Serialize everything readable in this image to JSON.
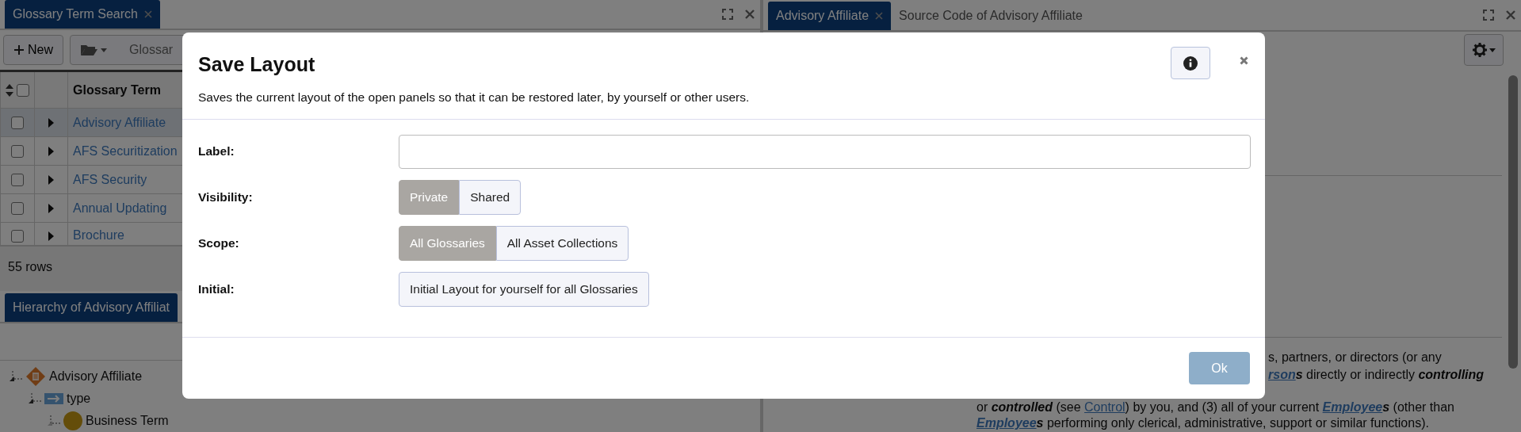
{
  "left_panel": {
    "tab": {
      "label": "Glossary Term Search"
    },
    "toolbar": {
      "new_button": "New",
      "column_3": "Glossar"
    },
    "table": {
      "select_all_checked": false,
      "columns": [
        "Glossary Term"
      ],
      "rows": [
        {
          "term": "Advisory Affiliate",
          "selected": true,
          "checked": false
        },
        {
          "term": "AFS Securitization",
          "selected": false,
          "checked": false
        },
        {
          "term": "AFS Security",
          "selected": false,
          "checked": false
        },
        {
          "term": "Annual Updating",
          "selected": false,
          "checked": false
        },
        {
          "term": "Brochure",
          "selected": false,
          "checked": false
        }
      ]
    },
    "row_count": "55 rows"
  },
  "hierarchy_panel": {
    "tab": {
      "label": "Hierarchy of Advisory Affiliat"
    },
    "tree": [
      {
        "label": "Advisory Affiliate",
        "kind": "term",
        "children": [
          {
            "label": "type",
            "kind": "relation",
            "children": [
              {
                "label": "Business Term",
                "kind": "type"
              }
            ]
          }
        ]
      }
    ]
  },
  "right_panel": {
    "tabs": [
      {
        "label": "Advisory Affiliate",
        "selected": true,
        "closable": true
      },
      {
        "label": "Source Code of Advisory Affiliate",
        "selected": false,
        "closable": false
      }
    ],
    "description_lines": [
      [
        {
          "kind": "text",
          "text": "s, partners, or directors (or any"
        }
      ],
      [
        {
          "kind": "term-link",
          "text": "rson"
        },
        {
          "kind": "emph",
          "text": "s"
        },
        {
          "kind": "text",
          "text": " directly or indirectly "
        },
        {
          "kind": "emph",
          "text": "controlling"
        }
      ],
      [
        {
          "kind": "text",
          "text": "or "
        },
        {
          "kind": "emph",
          "text": "controlled"
        },
        {
          "kind": "text",
          "text": " (see "
        },
        {
          "kind": "link",
          "text": "Control"
        },
        {
          "kind": "text",
          "text": ") by you, and (3) all of your current "
        },
        {
          "kind": "term-link",
          "text": "Employee"
        },
        {
          "kind": "emph",
          "text": "s"
        },
        {
          "kind": "text",
          "text": " (other than"
        }
      ],
      [
        {
          "kind": "term-link",
          "text": "Employee"
        },
        {
          "kind": "emph",
          "text": "s"
        },
        {
          "kind": "text",
          "text": " performing only clerical, administrative, support or similar functions)."
        }
      ]
    ]
  },
  "dialog": {
    "title": "Save Layout",
    "description": "Saves the current layout of the open panels so that it can be restored later, by yourself or other users.",
    "fields": [
      {
        "kind": "text",
        "label": "Label:"
      },
      {
        "kind": "toggle",
        "label": "Visibility:",
        "options": [
          {
            "label": "Private",
            "selected": true
          },
          {
            "label": "Shared",
            "selected": false
          }
        ]
      },
      {
        "kind": "toggle",
        "label": "Scope:",
        "options": [
          {
            "label": "All Glossaries",
            "selected": true
          },
          {
            "label": "All Asset Collections",
            "selected": false
          }
        ]
      },
      {
        "kind": "button",
        "label": "Initial:",
        "button": "Initial Layout for yourself for all Glossaries"
      }
    ],
    "ok_button": {
      "label": "Ok",
      "disabled": true
    }
  }
}
